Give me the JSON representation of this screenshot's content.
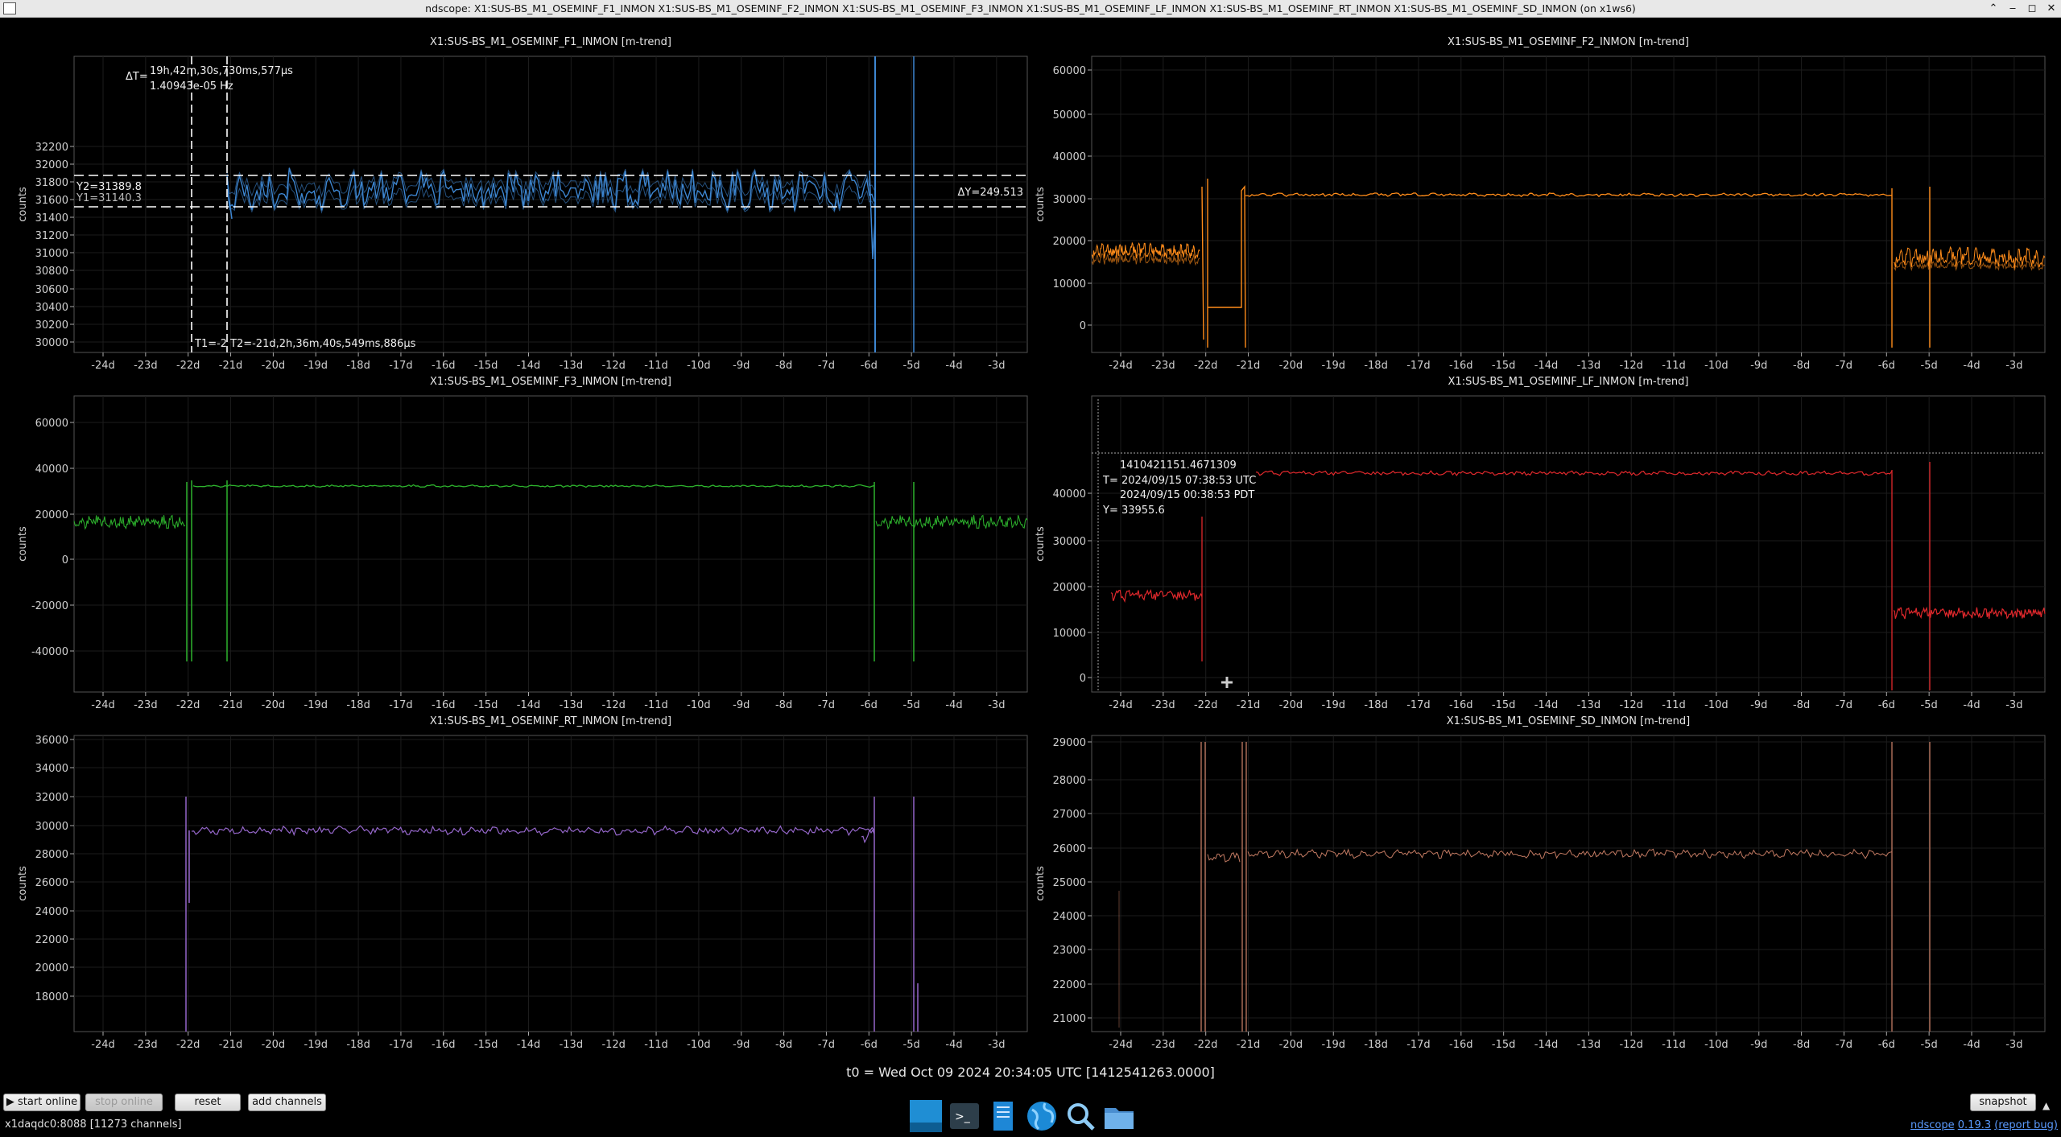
{
  "window": {
    "title": "ndscope: X1:SUS-BS_M1_OSEMINF_F1_INMON X1:SUS-BS_M1_OSEMINF_F2_INMON X1:SUS-BS_M1_OSEMINF_F3_INMON X1:SUS-BS_M1_OSEMINF_LF_INMON X1:SUS-BS_M1_OSEMINF_RT_INMON X1:SUS-BS_M1_OSEMINF_SD_INMON (on x1ws6)",
    "buttons": {
      "minimize": "‒",
      "maximize": "◻",
      "close": "✕",
      "shade": "⌃"
    }
  },
  "time_axis_labels": [
    "-24d",
    "-23d",
    "-22d",
    "-21d",
    "-20d",
    "-19d",
    "-18d",
    "-17d",
    "-16d",
    "-15d",
    "-14d",
    "-13d",
    "-12d",
    "-11d",
    "-10d",
    "-9d",
    "-8d",
    "-7d",
    "-6d",
    "-5d",
    "-4d",
    "-3d"
  ],
  "plots": [
    {
      "title": "X1:SUS-BS_M1_OSEMINF_F1_INMON [m-trend]",
      "ylabel": "counts",
      "color": "#3d86d1",
      "yticks": [
        "30000",
        "30200",
        "30400",
        "30600",
        "30800",
        "31000",
        "31200",
        "31400",
        "31600",
        "31800",
        "32000",
        "32200"
      ]
    },
    {
      "title": "X1:SUS-BS_M1_OSEMINF_F2_INMON [m-trend]",
      "ylabel": "counts",
      "color": "#ff8c1a",
      "yticks": [
        "0",
        "10000",
        "20000",
        "30000",
        "40000",
        "50000",
        "60000"
      ]
    },
    {
      "title": "X1:SUS-BS_M1_OSEMINF_F3_INMON [m-trend]",
      "ylabel": "counts",
      "color": "#2db32d",
      "yticks": [
        "-40000",
        "-20000",
        "0",
        "20000",
        "40000",
        "60000"
      ]
    },
    {
      "title": "X1:SUS-BS_M1_OSEMINF_LF_INMON [m-trend]",
      "ylabel": "counts",
      "color": "#e0282c",
      "yticks": [
        "0",
        "10000",
        "20000",
        "30000",
        "40000"
      ]
    },
    {
      "title": "X1:SUS-BS_M1_OSEMINF_RT_INMON [m-trend]",
      "ylabel": "counts",
      "color": "#9466c9",
      "yticks": [
        "18000",
        "20000",
        "22000",
        "24000",
        "26000",
        "28000",
        "30000",
        "32000",
        "34000",
        "36000"
      ]
    },
    {
      "title": "X1:SUS-BS_M1_OSEMINF_SD_INMON [m-trend]",
      "ylabel": "counts",
      "color": "#c27a62",
      "yticks": [
        "21000",
        "22000",
        "23000",
        "24000",
        "25000",
        "26000",
        "27000",
        "28000",
        "29000"
      ]
    }
  ],
  "cursors": {
    "delta_t": "ΔT=",
    "delta_t_value": "19h,42m,30s,730ms,577µs",
    "delta_t_freq": "1.40943e-05 Hz",
    "y2": "Y2=31389.8",
    "y1": "Y1=31140.3",
    "delta_y": "ΔY=249.513",
    "t1": "T1=-2",
    "t2": "T2=-21d,2h,36m,40s,549ms,886µs"
  },
  "crosshair": {
    "gps": "1410421151.4671309",
    "utc": "T= 2024/09/15 07:38:53 UTC",
    "pdt": "2024/09/15 00:38:53 PDT",
    "y": "Y= 33955.6"
  },
  "t0_label": "t0 = Wed Oct 09 2024 20:34:05 UTC [1412541263.0000]",
  "buttons": {
    "start_online": "▶ start online",
    "stop_online": "stop online",
    "reset": "reset",
    "add_channels": "add channels",
    "snapshot": "snapshot"
  },
  "status": "x1daqdc0:8088  [11273 channels]",
  "version": {
    "app": "ndscope",
    "ver": "0.19.3",
    "bug": "(report bug)"
  },
  "taskbar_icons": [
    "desktop-icon",
    "terminal-icon",
    "text-editor-icon",
    "browser-globe-icon",
    "search-icon",
    "folder-icon"
  ]
}
